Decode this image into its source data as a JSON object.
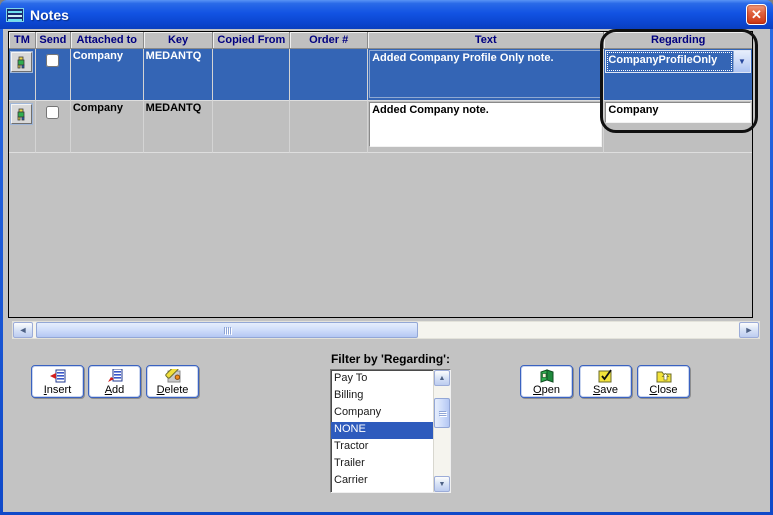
{
  "window": {
    "title": "Notes",
    "close_glyph": "✕"
  },
  "grid": {
    "headers": [
      "TM",
      "Send",
      "Attached to",
      "Key",
      "Copied From",
      "Order #",
      "Text",
      "Regarding"
    ],
    "rows": [
      {
        "attached_to": "Company",
        "key": "MEDANTQ",
        "copied_from": "",
        "order_no": "",
        "text": "Added Company Profile Only note.",
        "regarding": "CompanyProfileOnly"
      },
      {
        "attached_to": "Company",
        "key": "MEDANTQ",
        "copied_from": "",
        "order_no": "",
        "text": "Added Company note.",
        "regarding": "Company"
      }
    ]
  },
  "filter": {
    "label": "Filter by 'Regarding':",
    "options": [
      "Pay To",
      "Billing",
      "Company",
      "NONE",
      "Tractor",
      "Trailer",
      "Carrier"
    ],
    "selected_option": "NONE"
  },
  "actions": {
    "insert": {
      "mnemonic": "I",
      "rest": "nsert"
    },
    "add": {
      "mnemonic": "A",
      "rest": "dd"
    },
    "delete": {
      "mnemonic": "D",
      "rest": "elete"
    },
    "open": {
      "mnemonic": "O",
      "rest": "pen"
    },
    "save": {
      "mnemonic": "S",
      "rest": "ave"
    },
    "close": {
      "mnemonic": "C",
      "rest": "lose"
    }
  },
  "glyphs": {
    "combo_arrow": "▼",
    "scroll_left": "◄",
    "scroll_right": "►",
    "scroll_up": "▲",
    "scroll_down": "▼"
  },
  "colors": {
    "selection_blue": "#3465b5",
    "header_text_navy": "#000080",
    "titlebar_blue": "#1253e3",
    "list_highlight": "#2e5bbd",
    "close_red": "#cc3512"
  }
}
